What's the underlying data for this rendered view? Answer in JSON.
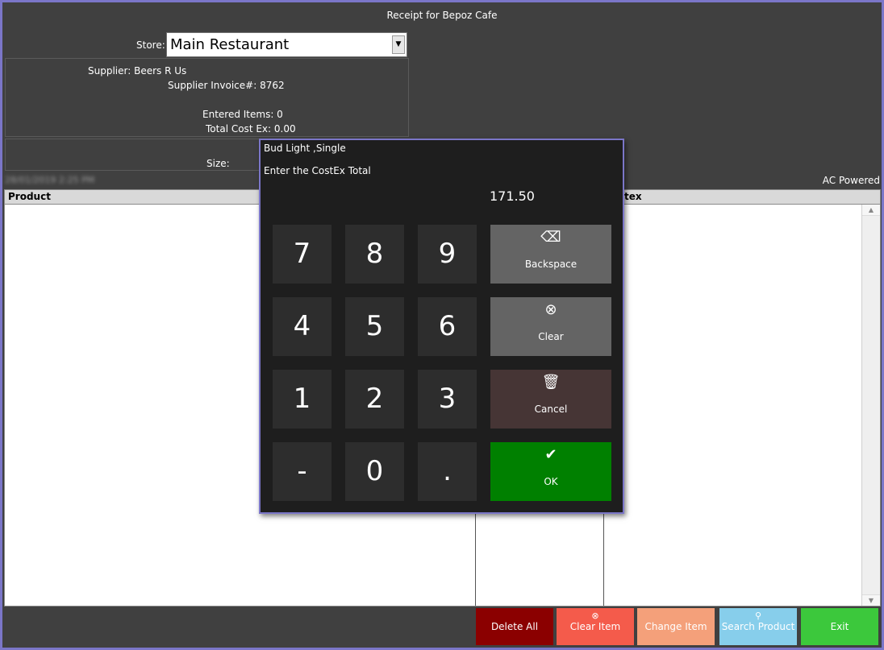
{
  "window": {
    "title": "Receipt for Bepoz Cafe"
  },
  "store": {
    "label": "Store:",
    "selected": "Main Restaurant",
    "arrow": "▼"
  },
  "info": {
    "supplier": "Supplier: Beers R Us",
    "invoice": "Supplier Invoice#: 8762",
    "entered_items": "Entered Items: 0",
    "total_cost": "Total Cost Ex: 0.00"
  },
  "size": {
    "label": "Size:"
  },
  "status": {
    "datetime": "28/01/2019 2:25 PM",
    "powered": "AC Powered"
  },
  "grid": {
    "columns": [
      "Product",
      "tex"
    ]
  },
  "keypad": {
    "item_name": "Bud Light ,Single",
    "prompt": "Enter the CostEx Total",
    "value": "171.50",
    "keys": [
      "7",
      "8",
      "9",
      "4",
      "5",
      "6",
      "1",
      "2",
      "3",
      "-",
      "0",
      "."
    ],
    "backspace": "Backspace",
    "clear": "Clear",
    "cancel": "Cancel",
    "ok": "OK"
  },
  "icons": {
    "backspace": "⌫",
    "clear": "⊗",
    "cancel": "🗑",
    "ok": "✔",
    "clear_item": "⊗",
    "search": "⚲"
  },
  "buttons": {
    "delete_all": "Delete All",
    "clear_item": "Clear Item",
    "change_item": "Change Item",
    "search_product": "Search Product",
    "exit": "Exit"
  },
  "colors": {
    "background": "#404040",
    "frame": "#7b76c8",
    "delete_all": "#8b0000",
    "clear_item": "#f45b4b",
    "change_item": "#f4a07a",
    "search_product": "#87ceeb",
    "exit": "#3cc83c",
    "key": "#2d2d2d",
    "backspace": "#646464",
    "cancel": "#463535",
    "ok": "#008000"
  }
}
